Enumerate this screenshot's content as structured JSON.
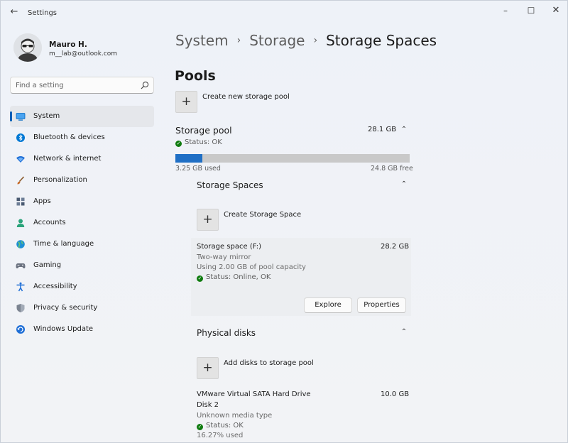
{
  "window": {
    "title": "Settings",
    "back_icon": "arrow-left-icon",
    "controls": {
      "minimize": "–",
      "maximize": "☐",
      "close": "✕"
    }
  },
  "profile": {
    "name": "Mauro H.",
    "email": "m__lab@outlook.com"
  },
  "search": {
    "placeholder": "Find a setting"
  },
  "sidebar": {
    "items": [
      {
        "label": "System",
        "icon": "monitor-icon",
        "color": "#0078d4",
        "active": true
      },
      {
        "label": "Bluetooth & devices",
        "icon": "bluetooth-icon",
        "color": "#0078d4"
      },
      {
        "label": "Network & internet",
        "icon": "wifi-icon",
        "color": "#1e6ed6"
      },
      {
        "label": "Personalization",
        "icon": "brush-icon",
        "color": "#c86b2a"
      },
      {
        "label": "Apps",
        "icon": "apps-icon",
        "color": "#4a5a72"
      },
      {
        "label": "Accounts",
        "icon": "person-icon",
        "color": "#2aa37a"
      },
      {
        "label": "Time & language",
        "icon": "globe-icon",
        "color": "#1e8fd6"
      },
      {
        "label": "Gaming",
        "icon": "gamepad-icon",
        "color": "#6b7280"
      },
      {
        "label": "Accessibility",
        "icon": "accessibility-icon",
        "color": "#1e6ed6"
      },
      {
        "label": "Privacy & security",
        "icon": "shield-icon",
        "color": "#6b7280"
      },
      {
        "label": "Windows Update",
        "icon": "update-icon",
        "color": "#1e6ed6"
      }
    ]
  },
  "breadcrumb": {
    "items": [
      "System",
      "Storage"
    ],
    "current": "Storage Spaces",
    "separator": "›"
  },
  "pools": {
    "title": "Pools",
    "create_label": "Create new storage pool",
    "pool": {
      "name": "Storage pool",
      "size": "28.1 GB",
      "status": "Status: OK",
      "used": "3.25 GB used",
      "free": "24.8 GB free",
      "used_fraction": 0.116
    }
  },
  "storage_spaces": {
    "title": "Storage Spaces",
    "create_label": "Create Storage Space",
    "space": {
      "name": "Storage space (F:)",
      "size": "28.2 GB",
      "resiliency": "Two-way mirror",
      "capacity": "Using 2.00 GB of pool capacity",
      "status": "Status: Online, OK",
      "explore_label": "Explore",
      "properties_label": "Properties"
    }
  },
  "physical_disks": {
    "title": "Physical disks",
    "add_label": "Add disks to storage pool",
    "disk": {
      "name": "VMware Virtual SATA Hard Drive",
      "number": "Disk 2",
      "size": "10.0 GB",
      "media": "Unknown media type",
      "status": "Status: OK",
      "used": "16.27% used"
    }
  },
  "colors": {
    "accent": "#005fb8",
    "bar_fill": "#1f6fc5",
    "status_ok": "#0f7b0f"
  }
}
